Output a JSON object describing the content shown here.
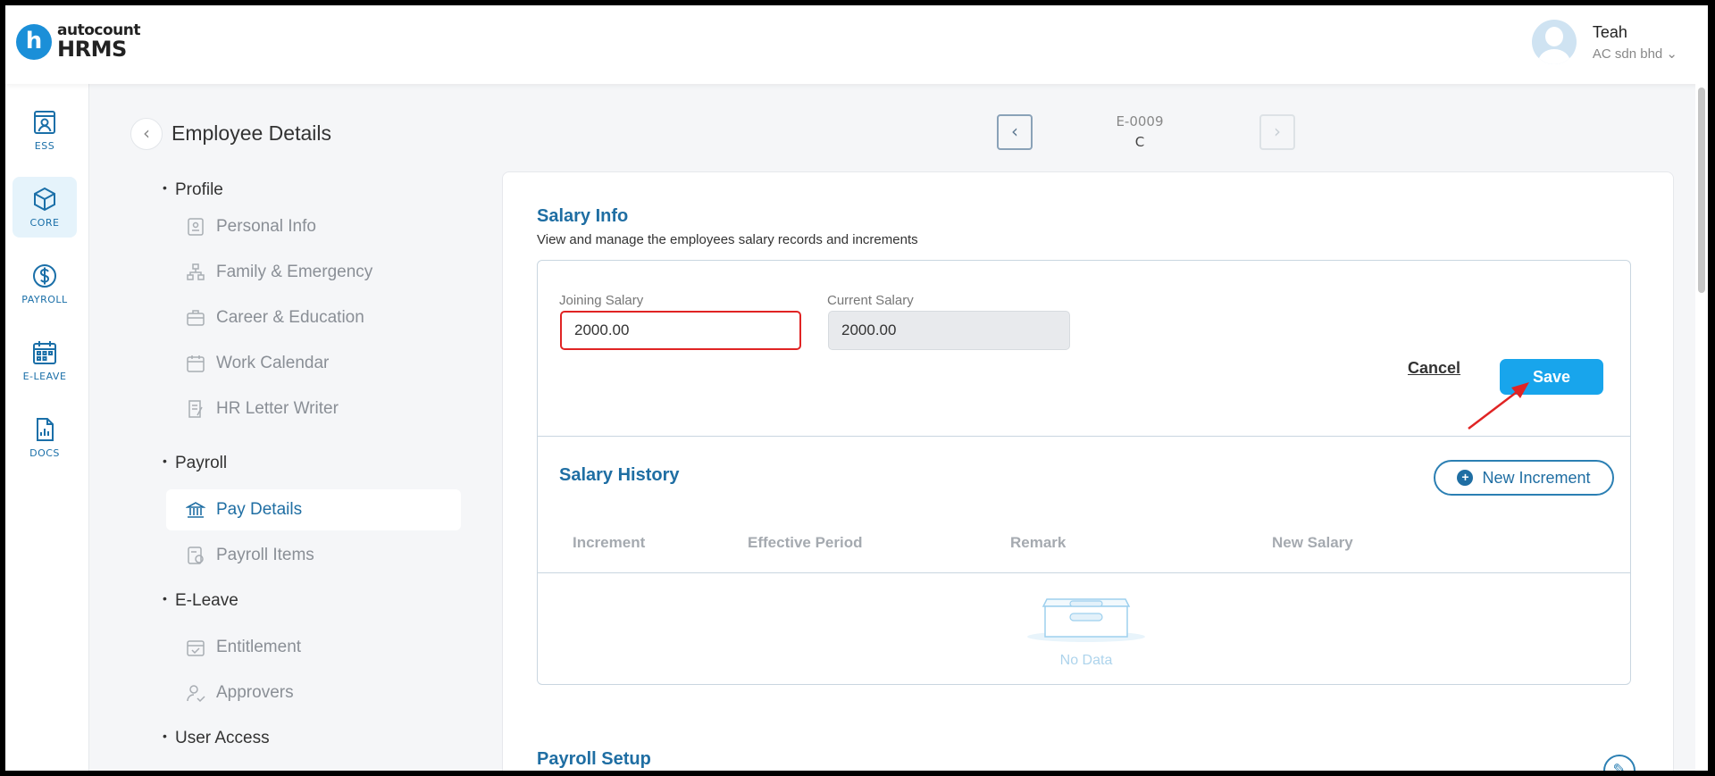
{
  "app": {
    "logo_top": "autocount",
    "logo_bottom": "HRMS",
    "logo_letter": "h",
    "brand_color": "#1b8fd8",
    "accent_color": "#1f6ea3"
  },
  "user": {
    "name": "Teah",
    "company": "AC sdn bhd ⌄"
  },
  "rail": [
    {
      "label": "ESS",
      "icon": "ess-icon"
    },
    {
      "label": "CORE",
      "icon": "core-icon",
      "active": true
    },
    {
      "label": "PAYROLL",
      "icon": "payroll-icon"
    },
    {
      "label": "E-LEAVE",
      "icon": "calendar-icon"
    },
    {
      "label": "DOCS",
      "icon": "docs-icon"
    }
  ],
  "header": {
    "title": "Employee Details",
    "employee_code": "E-0009",
    "employee_name": "C"
  },
  "menu": {
    "sections": [
      "Profile",
      "Payroll",
      "E-Leave",
      "User Access"
    ],
    "items": [
      {
        "label": "Personal Info",
        "icon": "id-card-icon"
      },
      {
        "label": "Family & Emergency",
        "icon": "family-icon"
      },
      {
        "label": "Career & Education",
        "icon": "briefcase-icon"
      },
      {
        "label": "Work Calendar",
        "icon": "calendar-icon"
      },
      {
        "label": "HR Letter Writer",
        "icon": "letter-icon"
      },
      {
        "label": "Pay Details",
        "icon": "bank-icon",
        "active": true
      },
      {
        "label": "Payroll Items",
        "icon": "payroll-items-icon"
      },
      {
        "label": "Entitlement",
        "icon": "calendar-check-icon"
      },
      {
        "label": "Approvers",
        "icon": "user-check-icon"
      }
    ]
  },
  "salary_info": {
    "title": "Salary Info",
    "subtitle": "View and manage the employees salary records and increments",
    "joining_label": "Joining Salary",
    "joining_value": "2000.00",
    "current_label": "Current Salary",
    "current_value": "2000.00",
    "cancel_label": "Cancel",
    "save_label": "Save"
  },
  "salary_history": {
    "title": "Salary History",
    "new_increment_label": "New Increment",
    "columns": [
      "Increment",
      "Effective Period",
      "Remark",
      "New Salary"
    ],
    "empty_text": "No Data"
  },
  "payroll_setup": {
    "title": "Payroll Setup"
  }
}
